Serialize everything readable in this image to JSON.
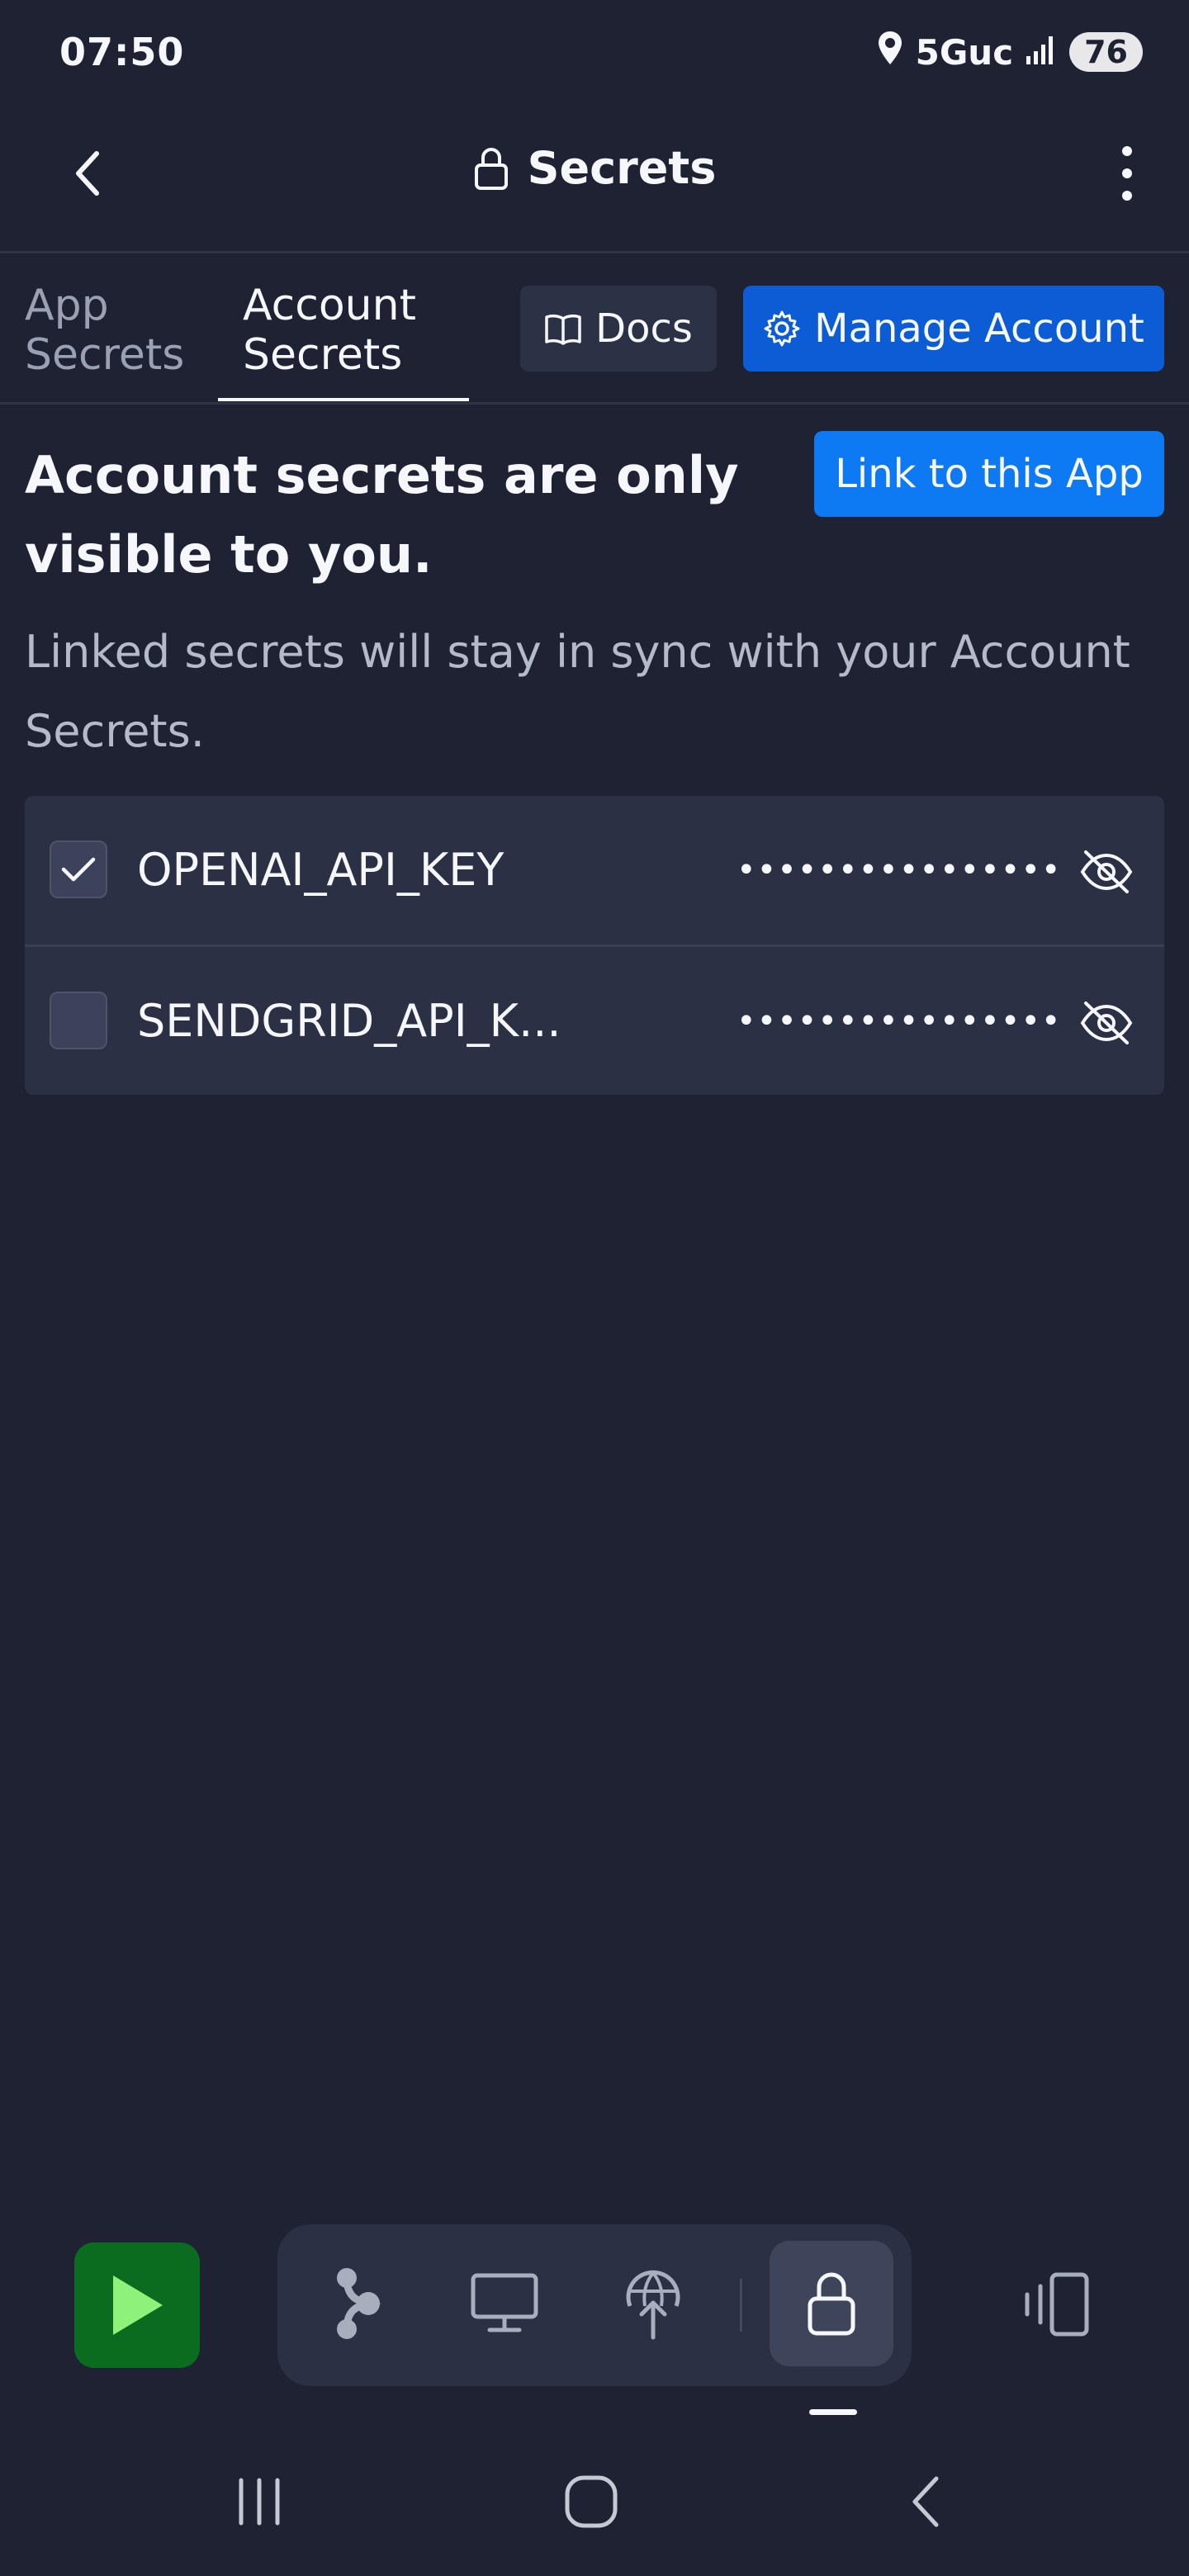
{
  "status_bar": {
    "time": "07:50",
    "network": "5Guc",
    "battery": "76"
  },
  "header": {
    "title": "Secrets"
  },
  "tabs": [
    {
      "line1": "App",
      "line2": "Secrets"
    },
    {
      "line1": "Account",
      "line2": "Secrets"
    }
  ],
  "actions": {
    "docs_label": "Docs",
    "manage_label": "Manage Account"
  },
  "info": {
    "title": "Account secrets are only visible to you.",
    "link_label": "Link to this App",
    "description": "Linked secrets will stay in sync with your Account Secrets."
  },
  "secrets": [
    {
      "name": "OPENAI_API_KEY",
      "masked": "••••••••••••••••",
      "checked": true
    },
    {
      "name": "SENDGRID_API_K...",
      "masked": "••••••••••••••••",
      "checked": false
    }
  ],
  "colors": {
    "accent": "#0d79f2",
    "manage_button": "#0b5cd5",
    "run_button": "#0b6b1f",
    "background": "#1e2233"
  }
}
